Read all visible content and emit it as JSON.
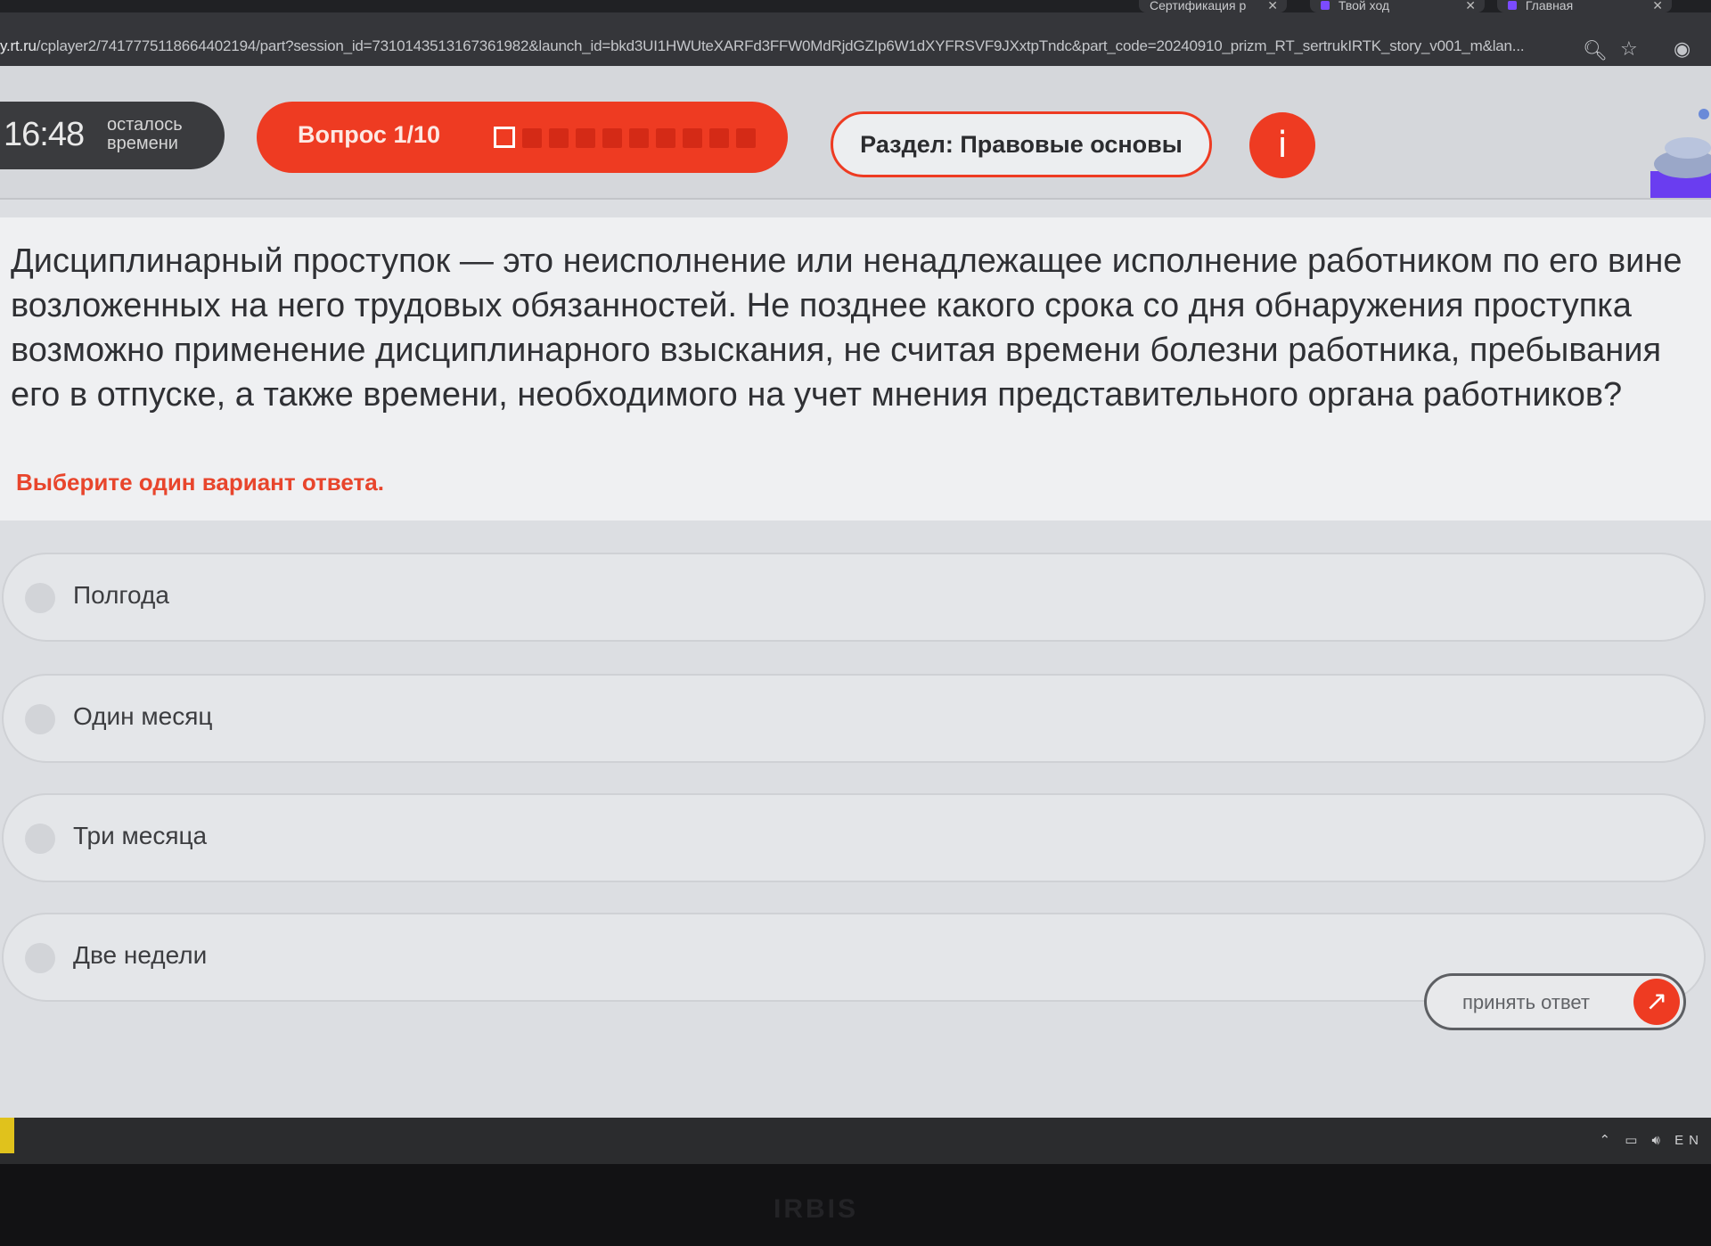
{
  "browser": {
    "tabs": [
      {
        "label": "Сертификация р"
      },
      {
        "label": "Твой ход"
      },
      {
        "label": "Главная"
      }
    ],
    "url_host": "y.rt.ru",
    "url_path": "/cplayer2/741777511866440219​4/part?session_id=731014351316736198​2&launch_id=bkd3UI1HWUteXARFd3FFW0MdRjdGZIp6W1dXYFRSVF9JXxtpTndc&part_code=20240910_prizm_RT_sertrukIRTK_story_v001_m&lan...",
    "icons": [
      "zoom-icon",
      "star-icon",
      "profile-icon"
    ]
  },
  "timer": {
    "time": "16:48",
    "label": "осталось времени"
  },
  "question_progress": {
    "label": "Вопрос 1/10",
    "current": 1,
    "total": 10
  },
  "section": {
    "label": "Раздел: Правовые основы"
  },
  "info_button": {
    "label": "i"
  },
  "question": {
    "text": "Дисциплинарный проступок — это неисполнение или ненадлежащее исполнение работником по его вине возложенных на него трудовых обязанностей. Не позднее какого срока со дня обнаружения проступка возможно применение дисциплинарного взыскания, не считая времени болезни работника, пребывания его в отпуске, а также времени, необходимого на учет мнения представительного органа работников?",
    "hint": "Выберите один вариант ответа."
  },
  "options": [
    {
      "label": "Полгода"
    },
    {
      "label": "Один месяц"
    },
    {
      "label": "Три месяца"
    },
    {
      "label": "Две недели"
    }
  ],
  "accept_button": {
    "label": "принять ответ"
  },
  "colors": {
    "accent": "#ee3b22",
    "hint": "#e8452c",
    "dark": "#3a3b3e"
  },
  "monitor_brand": "IRBIS"
}
